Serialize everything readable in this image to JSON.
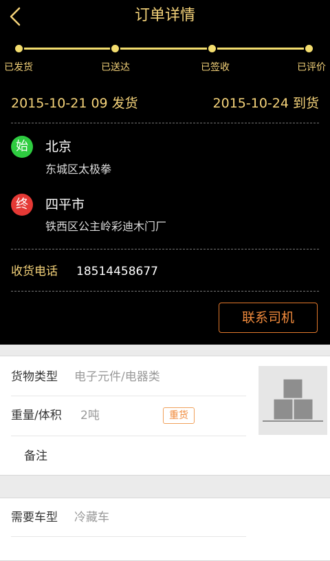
{
  "header": {
    "title": "订单详情"
  },
  "progress": {
    "steps": [
      {
        "label": "已发货"
      },
      {
        "label": "已送达"
      },
      {
        "label": "已签收"
      },
      {
        "label": "已评价"
      }
    ],
    "accent_color": "#f3dd6e"
  },
  "dates": {
    "ship": "2015-10-21 09 发货",
    "arrive": "2015-10-24 到货"
  },
  "route": {
    "start": {
      "badge": "始",
      "city": "北京",
      "address": "东城区太极拳",
      "color": "#2ecc40"
    },
    "end": {
      "badge": "终",
      "city": "四平市",
      "address": "铁西区公主岭彩迪木门厂",
      "color": "#e53935"
    }
  },
  "receiver": {
    "label": "收货电话",
    "phone": "18514458677"
  },
  "actions": {
    "contact_driver": "联系司机"
  },
  "cargo": {
    "type_label": "货物类型",
    "type_value": "电子元件/电器类",
    "weight_label": "重量/体积",
    "weight_value": "2吨",
    "weight_tag": "重货",
    "note_label": "备注",
    "image_icon": "boxes-icon"
  },
  "vehicle": {
    "type_label": "需要车型",
    "type_value": "冷藏车"
  }
}
